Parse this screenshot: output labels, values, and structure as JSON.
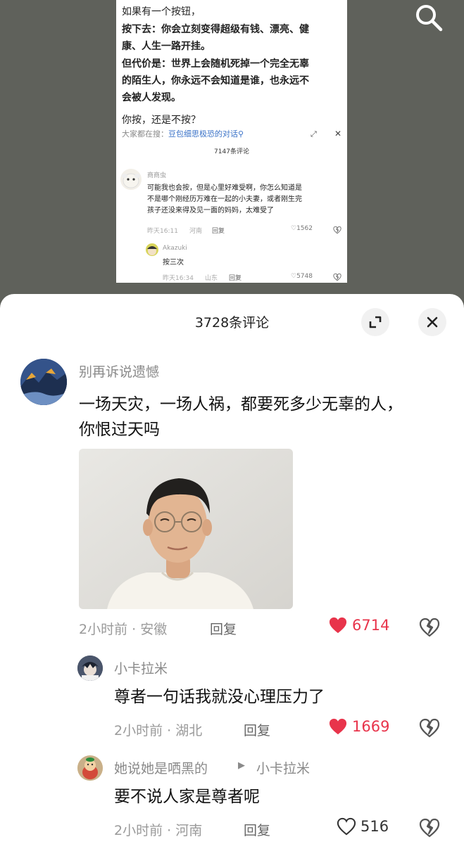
{
  "card": {
    "question": [
      "如果有一个按钮，",
      "按下去：你会立刻变得超级有钱、漂亮、健",
      "康、人生一路开挂。",
      "但代价是：世界上会随机死掉一个完全无辜",
      "的陌生人，你永远不会知道是谁，也永远不",
      "会被人发现。"
    ],
    "ask": "你按，还是不按？",
    "hint_prefix": "大家都在搜：",
    "hint_link": "豆包细思极恐的对话",
    "comment_count": "7147条评论",
    "comments": [
      {
        "name": "商商虫",
        "text": [
          "可能我也会按，但是心里好难受啊，你怎么知道是",
          "不是哪个刚经历万难在一起的小夫妻，或者刚生完",
          "孩子还没来得及见一面的妈妈，太难受了"
        ],
        "time": "昨天16:11",
        "location": "河南",
        "reply": "回复",
        "likes": "1562"
      },
      {
        "name": "Akazuki",
        "text": [
          "按三次"
        ],
        "time": "昨天16:34",
        "location": "山东",
        "reply": "回复",
        "likes": "5748"
      }
    ]
  },
  "sheet": {
    "title": "3728条评论",
    "comments": [
      {
        "user": "别再诉说遗憾",
        "text_lines": [
          "一场天灾，一场人祸，都要死多少无辜的人，",
          "你恨过天吗"
        ],
        "time_location": "2小时前 · 安徽",
        "reply": "回复",
        "likes": "6714",
        "liked": true
      },
      {
        "user": "小卡拉米",
        "text_lines": [
          "尊者一句话我就没心理压力了"
        ],
        "time_location": "2小时前 · 湖北",
        "reply": "回复",
        "likes": "1669",
        "liked": true
      },
      {
        "user": "她说她是哂黑的",
        "reply_to": "小卡拉米",
        "text_lines": [
          "要不说人家是尊者呢"
        ],
        "time_location": "2小时前 · 河南",
        "reply": "回复",
        "likes": "516",
        "liked": false
      }
    ]
  },
  "colors": {
    "like_red": "#e8344b",
    "like_count_red": "#e8344b",
    "link_blue": "#3b73c8",
    "background_dark": "#5f615b"
  },
  "icons": [
    "search-icon",
    "expand-icon",
    "close-icon",
    "heart-icon",
    "broken-heart-icon",
    "reply-arrow-icon"
  ]
}
